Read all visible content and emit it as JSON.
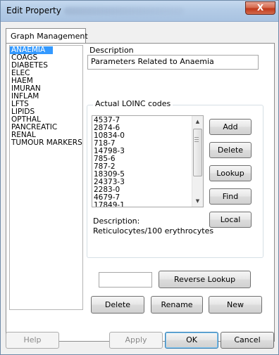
{
  "window": {
    "title": "Edit Property",
    "close_glyph": "X"
  },
  "tab": {
    "label": "Graph Management"
  },
  "groups": {
    "items": [
      "ANAEMIA",
      "COAGS",
      "DIABETES",
      "ELEC",
      "HAEM",
      "IMURAN",
      "INFLAM",
      "LFTS",
      "LIPIDS",
      "OPTHAL",
      "PANCREATIC",
      "RENAL",
      "TUMOUR MARKERS"
    ],
    "selected": "ANAEMIA"
  },
  "description": {
    "label": "Description",
    "value": "Parameters Related to Anaemia"
  },
  "loinc": {
    "group_label": "Actual LOINC codes",
    "codes": [
      "4537-7",
      "2874-6",
      "10834-0",
      "718-7",
      "14798-3",
      "785-6",
      "787-2",
      "18309-5",
      "24373-3",
      "2283-0",
      "4679-7",
      "17849-1"
    ],
    "description_label": "Description:",
    "description_value": "Reticulocytes/100 erythrocytes",
    "buttons": {
      "add": "Add",
      "delete": "Delete",
      "lookup": "Lookup",
      "find": "Find",
      "local": "Local"
    }
  },
  "reverse_lookup": {
    "input_value": "",
    "button": "Reverse Lookup"
  },
  "group_buttons": {
    "delete": "Delete",
    "rename": "Rename",
    "new": "New"
  },
  "dialog_buttons": {
    "help": "Help",
    "apply": "Apply",
    "ok": "OK",
    "cancel": "Cancel"
  },
  "icons": {
    "scroll_up": "scroll-up-arrow-icon",
    "scroll_down": "scroll-down-arrow-icon",
    "close": "close-icon"
  }
}
